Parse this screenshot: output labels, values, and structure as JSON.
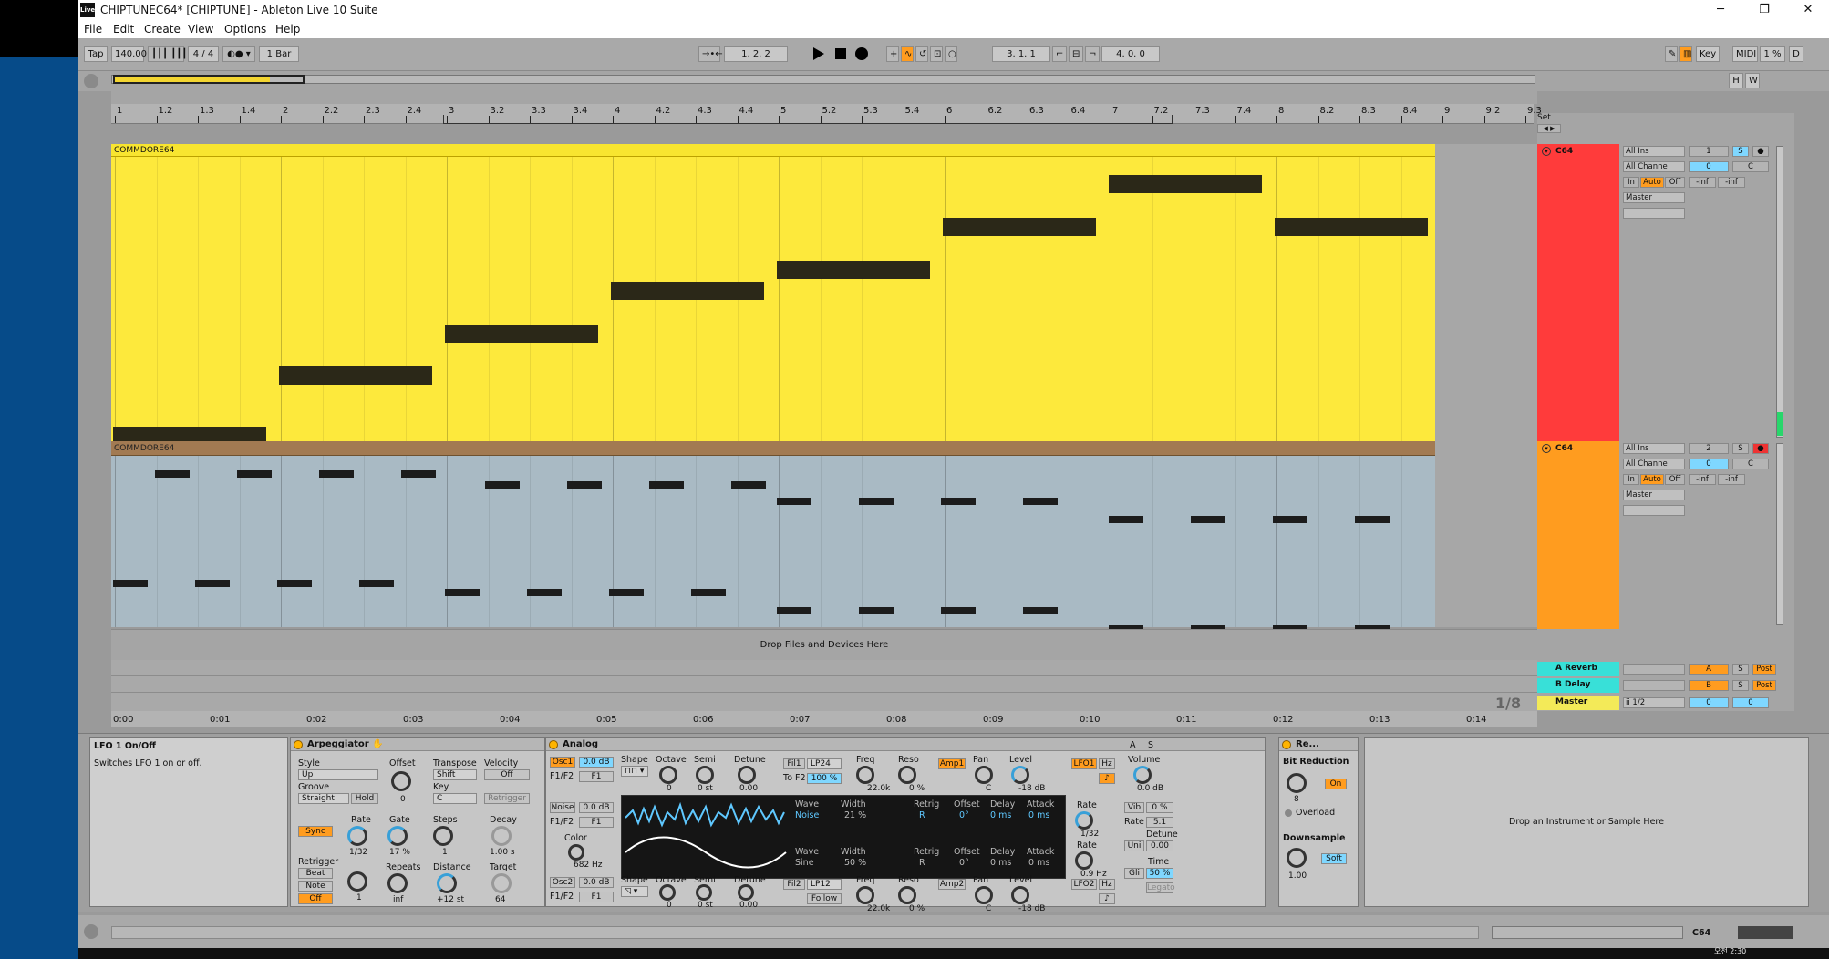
{
  "window": {
    "title": "CHIPTUNEC64*  [CHIPTUNE] - Ableton Live 10 Suite",
    "app_icon": "Live",
    "minimize": "─",
    "maximize": "❐",
    "close": "✕"
  },
  "menu": [
    "File",
    "Edit",
    "Create",
    "View",
    "Options",
    "Help"
  ],
  "transport": {
    "tap": "Tap",
    "tempo": "140.00",
    "time_sig": "4 / 4",
    "quantize": "1 Bar",
    "position": "1.  2.  2",
    "loop_start": "3.  1.  1",
    "loop_length": "4.  0.  0",
    "key": "Key",
    "midi": "MIDI",
    "cpu": "1 %",
    "d": "D"
  },
  "overview": {
    "h": "H",
    "w": "W"
  },
  "ruler_labels": [
    "1",
    "1.2",
    "1.3",
    "1.4",
    "2",
    "2.2",
    "2.3",
    "2.4",
    "3",
    "3.2",
    "3.3",
    "3.4",
    "4",
    "4.2",
    "4.3",
    "4.4",
    "5",
    "5.2",
    "5.3",
    "5.4",
    "6",
    "6.2",
    "6.3",
    "6.4",
    "7",
    "7.2",
    "7.3",
    "7.4",
    "8",
    "8.2",
    "8.3",
    "8.4",
    "9",
    "9.2",
    "9.3"
  ],
  "time_labels": [
    "0:00",
    "0:01",
    "0:02",
    "0:03",
    "0:04",
    "0:05",
    "0:06",
    "0:07",
    "0:08",
    "0:09",
    "0:10",
    "0:11",
    "0:12",
    "0:13",
    "0:14"
  ],
  "set_label": "Set",
  "clip1": {
    "name": "COMMDORE64"
  },
  "clip2": {
    "name": "COMMDORE64"
  },
  "tracks": [
    {
      "name": "C64",
      "color": "#ff3b3b",
      "input": "All Ins",
      "channel": "All Channe",
      "monitor_in": "In",
      "monitor_auto": "Auto",
      "monitor_off": "Off",
      "output": "Master",
      "number": "1",
      "vol": "0",
      "pan": "C",
      "solo": "S",
      "peak1": "-inf",
      "peak2": "-inf"
    },
    {
      "name": "C64",
      "color": "#ff9c1f",
      "input": "All Ins",
      "channel": "All Channe",
      "monitor_in": "In",
      "monitor_auto": "Auto",
      "monitor_off": "Off",
      "output": "Master",
      "number": "2",
      "vol": "0",
      "pan": "C",
      "solo": "S",
      "peak1": "-inf",
      "peak2": "-inf"
    }
  ],
  "drop_files": "Drop Files and Devices Here",
  "returns": [
    {
      "name": "A Reverb",
      "letter": "A",
      "solo": "S",
      "post": "Post"
    },
    {
      "name": "B Delay",
      "letter": "B",
      "solo": "S",
      "post": "Post"
    }
  ],
  "master": {
    "name": "Master",
    "output": "ii 1/2",
    "vol": "0",
    "pan": "0"
  },
  "grid_fraction": "1/8",
  "info": {
    "title": "LFO 1 On/Off",
    "text": "Switches LFO 1 on or off."
  },
  "arpeggiator": {
    "title": "Arpeggiator",
    "style_label": "Style",
    "style": "Up",
    "groove_label": "Groove",
    "groove": "Straight",
    "hold": "Hold",
    "offset_label": "Offset",
    "offset": "0",
    "transpose_label": "Transpose",
    "transpose": "Shift",
    "key_label": "Key",
    "key": "C",
    "velocity_label": "Velocity",
    "velocity": "Off",
    "retrigger_btn": "Retrigger",
    "sync": "Sync",
    "rate_label": "Rate",
    "rate": "1/32",
    "gate_label": "Gate",
    "gate": "17 %",
    "steps_label": "Steps",
    "steps": "1",
    "decay_label": "Decay",
    "decay": "1.00 s",
    "retrigger_label": "Retrigger",
    "beat": "Beat",
    "note": "Note",
    "off": "Off",
    "repeats_label": "Repeats",
    "repeats": "inf",
    "distance_label": "Distance",
    "distance": "+12 st",
    "target_label": "Target",
    "target": "64",
    "first_val": "1"
  },
  "analog": {
    "title": "Analog",
    "osc1": "Osc1",
    "osc1_level": "0.0 dB",
    "f1f2": "F1/F2",
    "f1": "F1",
    "shape_label": "Shape",
    "octave_label": "Octave",
    "octave": "0",
    "semi_label": "Semi",
    "semi": "0 st",
    "detune_label": "Detune",
    "detune": "0.00",
    "fil1": "Fil1",
    "lp24": "LP24",
    "to_f2": "To F2",
    "to_f2_val": "100 %",
    "freq_label": "Freq",
    "freq": "22.0k",
    "reso_label": "Reso",
    "reso": "0 %",
    "amp1": "Amp1",
    "pan_label": "Pan",
    "pan": "C",
    "level_label": "Level",
    "level": "-18 dB",
    "lfo1": "LFO1",
    "hz": "Hz",
    "noise": "Noise",
    "noise_level": "0.0 dB",
    "color_label": "Color",
    "color": "682 Hz",
    "wave_label": "Wave",
    "wave1": "Noise",
    "width_label": "Width",
    "width1": "21 %",
    "retrig_label": "Retrig",
    "r": "R",
    "offset_label": "Offset",
    "offset": "0°",
    "delay_label": "Delay",
    "delay": "0 ms",
    "attack_label": "Attack",
    "attack": "0 ms",
    "wave2": "Sine",
    "width2": "50 %",
    "osc2": "Osc2",
    "osc2_level": "0.0 dB",
    "fil2": "Fil2",
    "lp12": "LP12",
    "follow": "Follow",
    "amp2": "Amp2",
    "lfo2": "LFO2",
    "rate_label": "Rate",
    "rate1": "1/32",
    "rate2": "0.9 Hz",
    "volume_label": "Volume",
    "volume": "0.0 dB",
    "vib": "Vib",
    "vib_val": "0 %",
    "rate_field": "5.1",
    "uni": "Uni",
    "uni_val": "0.00",
    "detune2_label": "Detune",
    "gli": "Gli",
    "gli_val": "50 %",
    "time_label": "Time",
    "legato": "Legato",
    "a_label": "A",
    "s_label": "S"
  },
  "redux": {
    "title": "Re...",
    "bit_label": "Bit Reduction",
    "bit": "8",
    "on": "On",
    "overload": "Overload",
    "down_label": "Downsample",
    "down": "1.00",
    "soft": "Soft"
  },
  "drop_instrument": "Drop an Instrument or Sample Here",
  "status": {
    "track": "C64"
  },
  "tray": {
    "ampm": "오전",
    "time": "2:30"
  }
}
